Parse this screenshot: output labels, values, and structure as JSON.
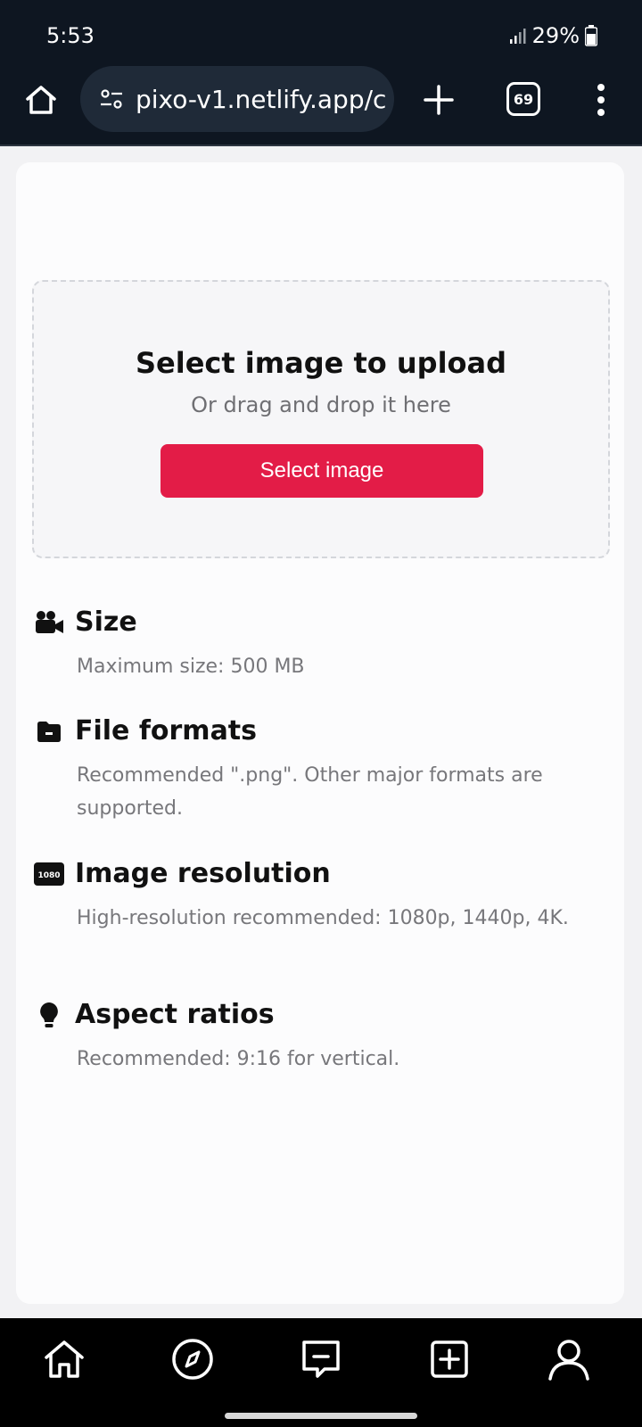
{
  "status": {
    "time": "5:53",
    "battery": "29%"
  },
  "browser": {
    "url": "pixo-v1.netlify.app/c",
    "tab_count": "69"
  },
  "upload": {
    "title": "Select image to upload",
    "subtitle": "Or drag and drop it here",
    "button_label": "Select image"
  },
  "info": [
    {
      "icon": "video-camera-icon",
      "title": "Size",
      "desc": "Maximum size: 500 MB"
    },
    {
      "icon": "folder-icon",
      "title": "File formats",
      "desc": "Recommended \".png\". Other major formats are supported."
    },
    {
      "icon": "resolution-1080-icon",
      "icon_text": "1080",
      "title": "Image resolution",
      "desc": "High-resolution recommended: 1080p, 1440p, 4K."
    },
    {
      "icon": "lightbulb-icon",
      "title": "Aspect ratios",
      "desc": "Recommended: 9:16 for vertical."
    }
  ],
  "bottom_nav": [
    "home-icon",
    "compass-icon",
    "feedback-icon",
    "add-icon",
    "profile-icon"
  ],
  "colors": {
    "accent": "#e31c47",
    "chrome": "#0e1621"
  }
}
